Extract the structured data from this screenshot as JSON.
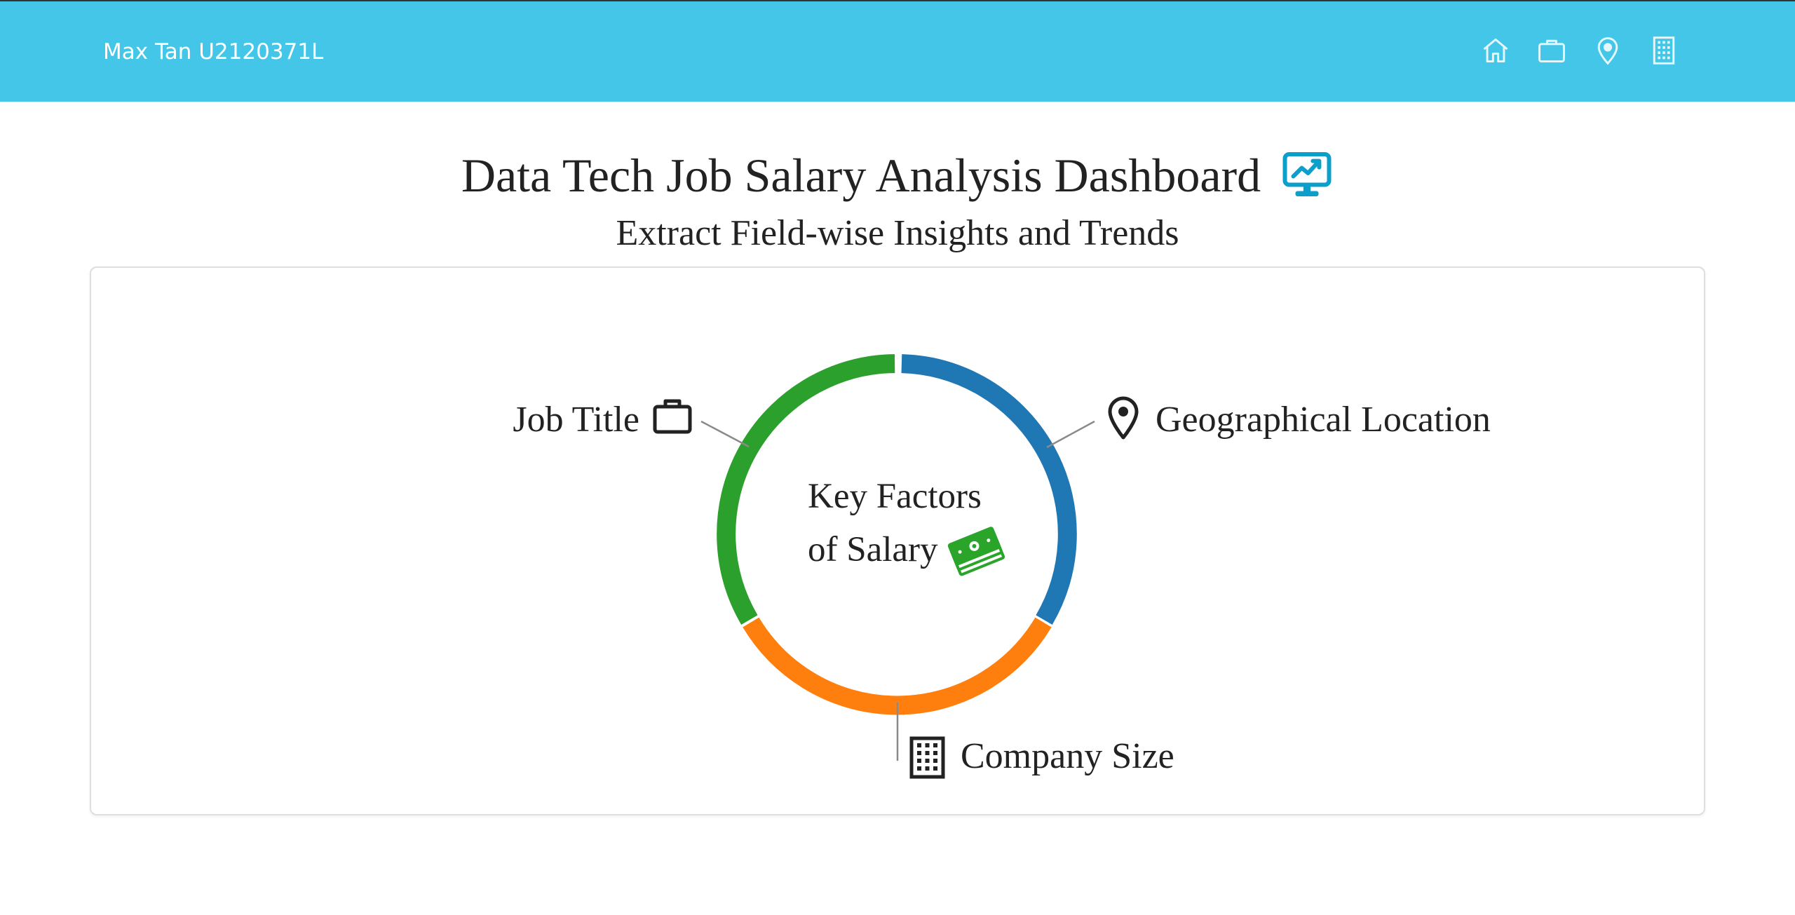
{
  "navbar": {
    "brand": "Max Tan U2120371L",
    "bg_color": "#43c6e8",
    "icons": [
      "home-icon",
      "briefcase-icon",
      "geo-icon",
      "building-icon"
    ]
  },
  "header": {
    "title": "Data Tech Job Salary Analysis Dashboard",
    "title_icon": "display-chart-icon",
    "subtitle": "Extract Field-wise Insights and Trends"
  },
  "donut": {
    "center_line1": "Key Factors",
    "center_line2": "of Salary",
    "center_icon": "cash-stack-icon",
    "segments": [
      {
        "label": "Geographical Location",
        "icon": "geo-icon",
        "color": "#1f77b4"
      },
      {
        "label": "Company Size",
        "icon": "building-icon",
        "color": "#ff7f0e"
      },
      {
        "label": "Job Title",
        "icon": "briefcase-icon",
        "color": "#2ca02c"
      }
    ]
  }
}
